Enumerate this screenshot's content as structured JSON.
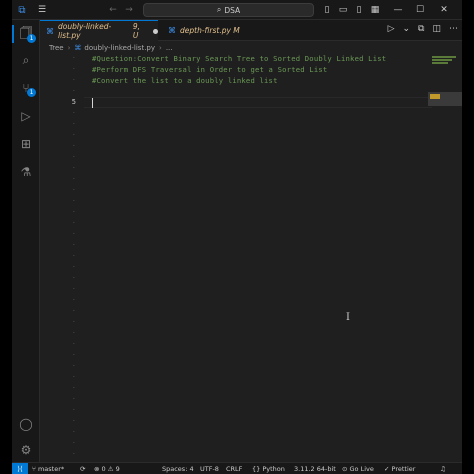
{
  "titlebar": {
    "search_label": "DSA"
  },
  "activity": {
    "explorer_badge": "1",
    "source_control_badge": "1"
  },
  "tabs": [
    {
      "label": "doubly-linked-list.py",
      "status": "9, U"
    },
    {
      "label": "depth-first.py",
      "status": "M"
    }
  ],
  "breadcrumb": {
    "folder": "Tree",
    "file": "doubly-linked-list.py",
    "more": "..."
  },
  "editor": {
    "lines": [
      {
        "num": "",
        "text": "#Question:Convert Binary Search Tree to Sorted Doubly Linked List"
      },
      {
        "num": "",
        "text": "#Perform DFS Traversal in Order to get a Sorted List"
      },
      {
        "num": "",
        "text": "#Convert the list to a doubly linked list"
      },
      {
        "num": "",
        "text": ""
      },
      {
        "num": "5",
        "text": ""
      }
    ],
    "current_line": "5"
  },
  "statusbar": {
    "branch": "master*",
    "errors": "0",
    "warnings": "9",
    "spaces": "Spaces: 4",
    "encoding": "UTF-8",
    "eol": "CRLF",
    "language": "Python",
    "interpreter": "3.11.2 64-bit",
    "go_live": "Go Live",
    "prettier": "Prettier"
  },
  "colors": {
    "accent": "#0078d4",
    "comment": "#6a9955",
    "modified_tab": "#e2c08d",
    "python_icon": "#3b8eea"
  }
}
